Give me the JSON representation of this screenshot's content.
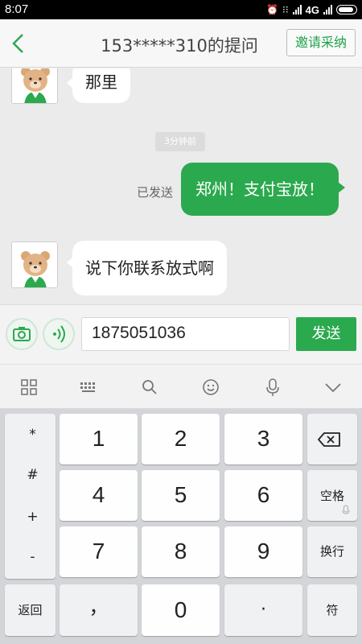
{
  "status_bar": {
    "time": "8:07",
    "network": "4G"
  },
  "header": {
    "title": "153*****310的提问",
    "accept_label": "邀请采纳"
  },
  "chat": {
    "messages": [
      {
        "side": "left",
        "text": "那里"
      },
      {
        "side": "right",
        "text": "郑州！支付宝放！",
        "status": "已发送"
      },
      {
        "side": "left",
        "text": "说下你联系放式啊"
      }
    ],
    "timestamp": "3分钟前"
  },
  "input_bar": {
    "value": "1875051036",
    "send_label": "发送"
  },
  "keyboard": {
    "symbols": [
      "*",
      "#",
      "+",
      "-"
    ],
    "digits": [
      "1",
      "2",
      "3",
      "4",
      "5",
      "6",
      "7",
      "8",
      "9",
      "0"
    ],
    "space_label": "空格",
    "newline_label": "换行",
    "return_label": "返回",
    "comma_label": "，",
    "dot_label": "·",
    "symbols_label": "符"
  },
  "colors": {
    "accent": "#2ba94e",
    "background": "#ebebeb"
  }
}
